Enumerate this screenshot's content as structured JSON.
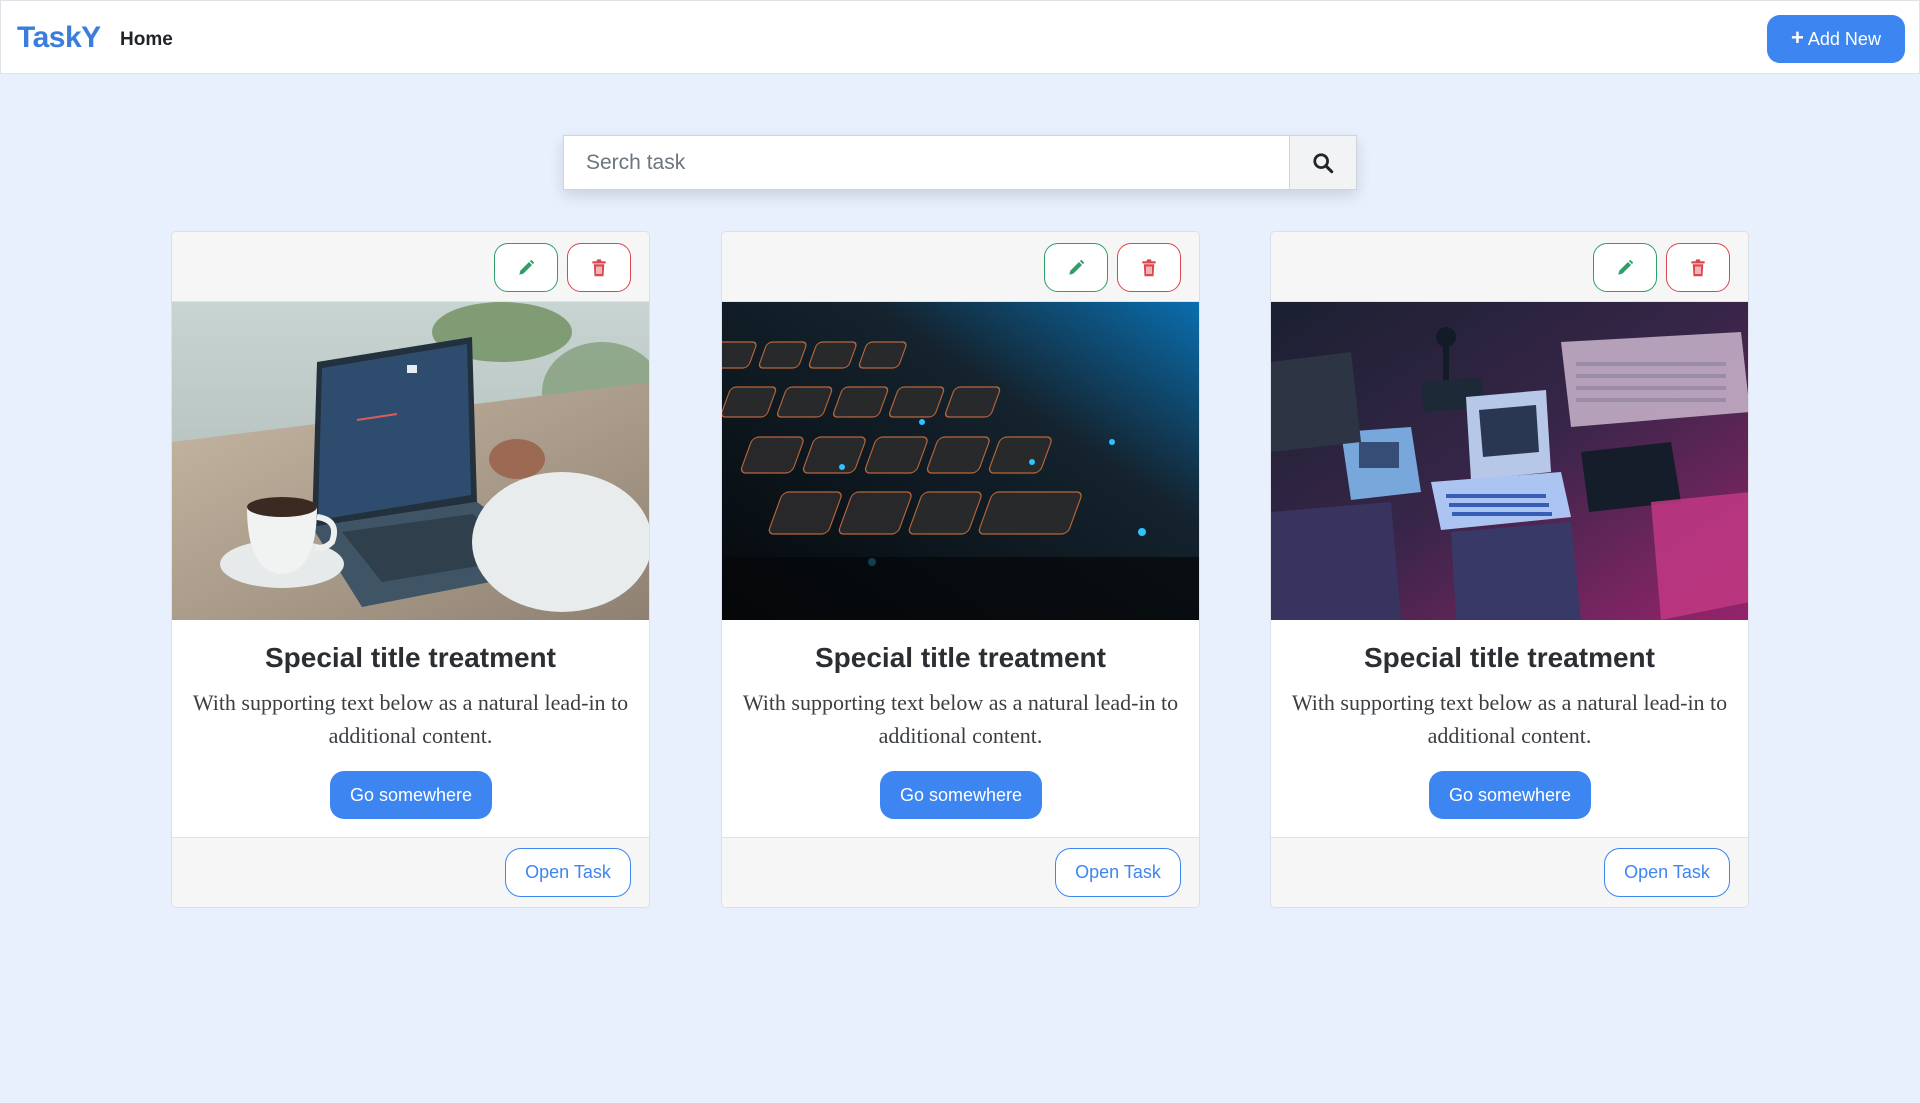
{
  "app": {
    "brand": "TaskY",
    "nav_home": "Home",
    "add_new_label": "Add New",
    "accent_color": "#3d85f0"
  },
  "search": {
    "placeholder": "Serch task",
    "value": "",
    "button_icon": "search-icon"
  },
  "cards": [
    {
      "image_icon": "laptop-coffee-photo",
      "title": "Special title treatment",
      "text": "With supporting text below as a natural lead-in to additional content.",
      "go_label": "Go somewhere",
      "open_label": "Open Task",
      "edit_icon": "pencil-icon",
      "delete_icon": "trash-icon"
    },
    {
      "image_icon": "keyboard-photo",
      "title": "Special title treatment",
      "text": "With supporting text below as a natural lead-in to additional content.",
      "go_label": "Go somewhere",
      "open_label": "Open Task",
      "edit_icon": "pencil-icon",
      "delete_icon": "trash-icon"
    },
    {
      "image_icon": "retro-computers-photo",
      "title": "Special title treatment",
      "text": "With supporting text below as a natural lead-in to additional content.",
      "go_label": "Go somewhere",
      "open_label": "Open Task",
      "edit_icon": "pencil-icon",
      "delete_icon": "trash-icon"
    }
  ]
}
